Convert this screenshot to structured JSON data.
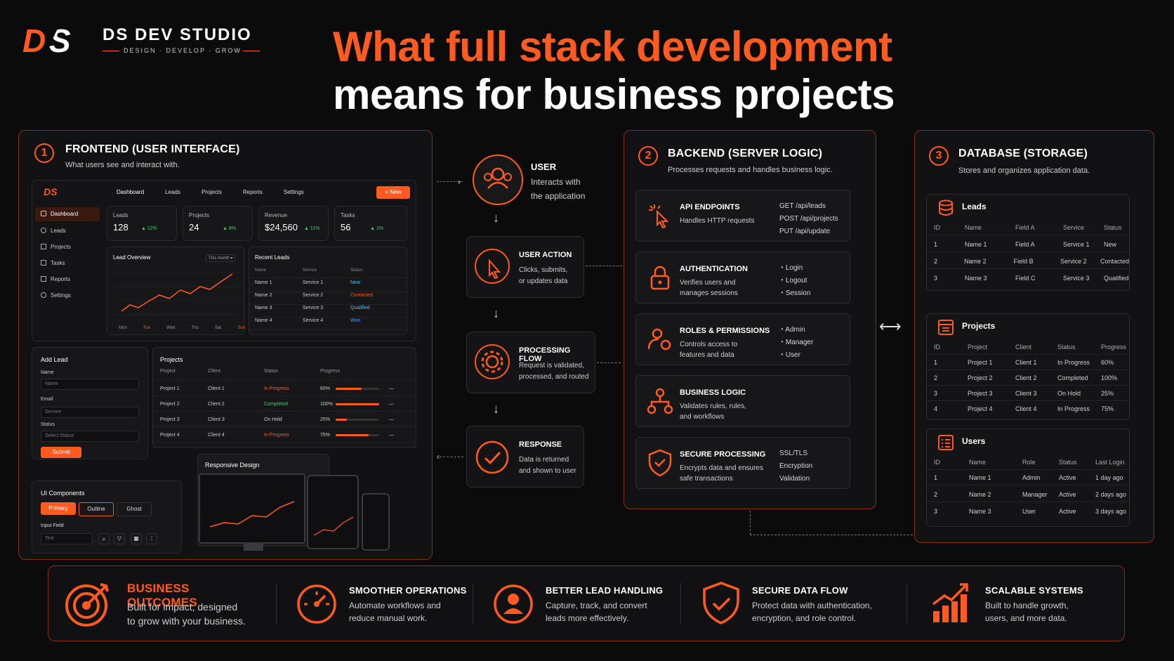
{
  "brand": {
    "logo": "DS",
    "name": "DS DEV STUDIO",
    "tagline": "DESIGN · DEVELOP · GROW"
  },
  "title": {
    "line1": "What full stack development",
    "line2": "means for business projects"
  },
  "frontend": {
    "num": "1",
    "title": "FRONTEND (USER INTERFACE)",
    "subtitle": "What users see and interact with.",
    "mock": {
      "logo": "DS",
      "nav": [
        "Dashboard",
        "Leads",
        "Projects",
        "Reports",
        "Settings"
      ],
      "new_btn": "+ New",
      "sidebar": [
        "Dashboard",
        "Leads",
        "Projects",
        "Tasks",
        "Reports",
        "Settings"
      ],
      "stats": [
        {
          "label": "Leads",
          "value": "128",
          "delta": "▲ 12%"
        },
        {
          "label": "Projects",
          "value": "24",
          "delta": "▲ 8%"
        },
        {
          "label": "Revenue",
          "value": "$24,560",
          "delta": "▲ 11%"
        },
        {
          "label": "Tasks",
          "value": "56",
          "delta": "▲ 1%"
        }
      ],
      "overview": {
        "title": "Lead Overview",
        "range": "This month ▾",
        "days": [
          "Mon",
          "Tue",
          "Wed",
          "Thu",
          "Sat",
          "Sun"
        ]
      },
      "recent": {
        "title": "Recent Leads",
        "headers": [
          "Name",
          "Service",
          "Status"
        ],
        "rows": [
          [
            "Name 1",
            "Service 1",
            "New"
          ],
          [
            "Name 2",
            "Service 2",
            "Contacted"
          ],
          [
            "Name 3",
            "Service 3",
            "Qualified"
          ],
          [
            "Name 4",
            "Service 4",
            "Won"
          ]
        ]
      },
      "addlead": {
        "title": "Add Lead",
        "name_label": "Name",
        "name_ph": "Name",
        "email_label": "Email",
        "service_ph": "Service",
        "status_label": "Status",
        "status_ph": "Select Status",
        "submit": "Submit"
      },
      "projects": {
        "title": "Projects",
        "headers": [
          "Project",
          "Client",
          "Status",
          "Progress"
        ],
        "rows": [
          {
            "p": "Project 1",
            "c": "Client 1",
            "s": "In Progress",
            "pct": "60%",
            "v": 0.6
          },
          {
            "p": "Project 2",
            "c": "Client 2",
            "s": "Completed",
            "pct": "100%",
            "v": 1.0
          },
          {
            "p": "Project 3",
            "c": "Client 3",
            "s": "On Hold",
            "pct": "25%",
            "v": 0.25
          },
          {
            "p": "Project 4",
            "c": "Client 4",
            "s": "In Progress",
            "pct": "75%",
            "v": 0.75
          }
        ],
        "more": "—"
      },
      "components": {
        "title": "UI Components",
        "primary": "Primary",
        "outline": "Outline",
        "ghost": "Ghost",
        "input_label": "Input Field",
        "input_ph": "Text"
      },
      "responsive": {
        "title": "Responsive Design"
      }
    }
  },
  "flow": {
    "user": {
      "title": "USER",
      "desc1": "Interacts with",
      "desc2": "the application"
    },
    "action": {
      "title": "USER ACTION",
      "desc1": "Clicks, submits,",
      "desc2": "or updates data"
    },
    "processing": {
      "title": "PROCESSING FLOW",
      "desc1": "Request is validated,",
      "desc2": "processed, and routed"
    },
    "response": {
      "title": "RESPONSE",
      "desc1": "Data is returned",
      "desc2": "and shown to user"
    }
  },
  "backend": {
    "num": "2",
    "title": "BACKEND (SERVER LOGIC)",
    "subtitle": "Processes requests and handles business logic.",
    "items": [
      {
        "title": "API ENDPOINTS",
        "d1": "Handles HTTP requests",
        "d2": "",
        "r": [
          "GET /api/leads",
          "POST /api/projects",
          "PUT /api/update"
        ]
      },
      {
        "title": "AUTHENTICATION",
        "d1": "Verifies users and",
        "d2": "manages sessions",
        "r": [
          "Login",
          "Logout",
          "Session"
        ]
      },
      {
        "title": "ROLES & PERMISSIONS",
        "d1": "Controls access to",
        "d2": "features and data",
        "r": [
          "Admin",
          "Manager",
          "User"
        ]
      },
      {
        "title": "BUSINESS LOGIC",
        "d1": "Validates rules, rules,",
        "d2": "and workflows",
        "r": []
      },
      {
        "title": "SECURE PROCESSING",
        "d1": "Encrypts data and ensures",
        "d2": "safe transactions",
        "r": [
          "SSL/TLS",
          "Encryption",
          "Validation"
        ]
      }
    ]
  },
  "database": {
    "num": "3",
    "title": "DATABASE (STORAGE)",
    "subtitle": "Stores and organizes application data.",
    "leads": {
      "title": "Leads",
      "headers": [
        "ID",
        "Name",
        "Field A",
        "Service",
        "Status"
      ],
      "rows": [
        [
          "1",
          "Name 1",
          "Field A",
          "Service 1",
          "New"
        ],
        [
          "2",
          "Name 2",
          "Field B",
          "Service 2",
          "Contacted"
        ],
        [
          "3",
          "Name 3",
          "Field C",
          "Service 3",
          "Qualified"
        ]
      ]
    },
    "projects": {
      "title": "Projects",
      "headers": [
        "ID",
        "Project",
        "Client",
        "Status",
        "Progress"
      ],
      "rows": [
        [
          "1",
          "Project 1",
          "Client 1",
          "In Progress",
          "60%"
        ],
        [
          "2",
          "Project 2",
          "Client 2",
          "Completed",
          "100%"
        ],
        [
          "3",
          "Project 3",
          "Client 3",
          "On Hold",
          "25%"
        ],
        [
          "4",
          "Project 4",
          "Client 4",
          "In Progress",
          "75%"
        ]
      ]
    },
    "users": {
      "title": "Users",
      "headers": [
        "ID",
        "Name",
        "Role",
        "Status",
        "Last Login"
      ],
      "rows": [
        [
          "1",
          "Name 1",
          "Admin",
          "Active",
          "1 day ago"
        ],
        [
          "2",
          "Name 2",
          "Manager",
          "Active",
          "2 days ago"
        ],
        [
          "3",
          "Name 3",
          "User",
          "Active",
          "3 days ago"
        ]
      ]
    }
  },
  "outcomes": [
    {
      "title": "BUSINESS OUTCOMES",
      "d1": "Built for impact, designed",
      "d2": "to grow with your business."
    },
    {
      "title": "SMOOTHER OPERATIONS",
      "d1": "Automate workflows and",
      "d2": "reduce manual work."
    },
    {
      "title": "BETTER LEAD HANDLING",
      "d1": "Capture, track, and convert",
      "d2": "leads more effectively."
    },
    {
      "title": "SECURE DATA FLOW",
      "d1": "Protect data with authentication,",
      "d2": "encryption, and role control."
    },
    {
      "title": "SCALABLE SYSTEMS",
      "d1": "Built to handle growth,",
      "d2": "users, and more data."
    }
  ],
  "colors": {
    "accent": "#ff5a1f",
    "bg": "#0b0b0c"
  }
}
